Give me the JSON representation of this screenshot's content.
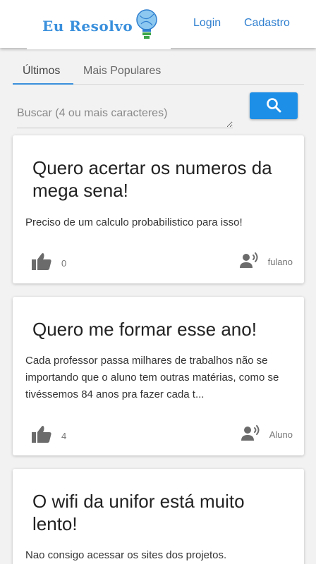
{
  "header": {
    "logo_text": "Eu Resolvo",
    "login_label": "Login",
    "signup_label": "Cadastro"
  },
  "tabs": [
    {
      "label": "Últimos",
      "active": true
    },
    {
      "label": "Mais Populares",
      "active": false
    }
  ],
  "search": {
    "placeholder": "Buscar (4 ou mais caracteres)",
    "value": ""
  },
  "colors": {
    "accent": "#1e8fe6",
    "link": "#2f7fcf",
    "icon_gray": "#666666"
  },
  "posts": [
    {
      "title": "Quero acertar os numeros da mega sena!",
      "body": "Preciso de um calculo probabilistico para isso!",
      "likes": "0",
      "author": "fulano"
    },
    {
      "title": "Quero me formar esse ano!",
      "body": "Cada professor passa milhares de trabalhos não se importando que o aluno tem outras matérias, como se tivéssemos 84 anos pra fazer cada t...",
      "likes": "4",
      "author": "Aluno"
    },
    {
      "title": "O wifi da unifor está muito lento!",
      "body": "Nao consigo acessar os sites dos projetos.",
      "likes": "",
      "author": ""
    }
  ],
  "icons": {
    "logo": "lightbulb-icon",
    "search": "search-icon",
    "like": "thumbs-up-icon",
    "author": "person-speaking-icon"
  }
}
